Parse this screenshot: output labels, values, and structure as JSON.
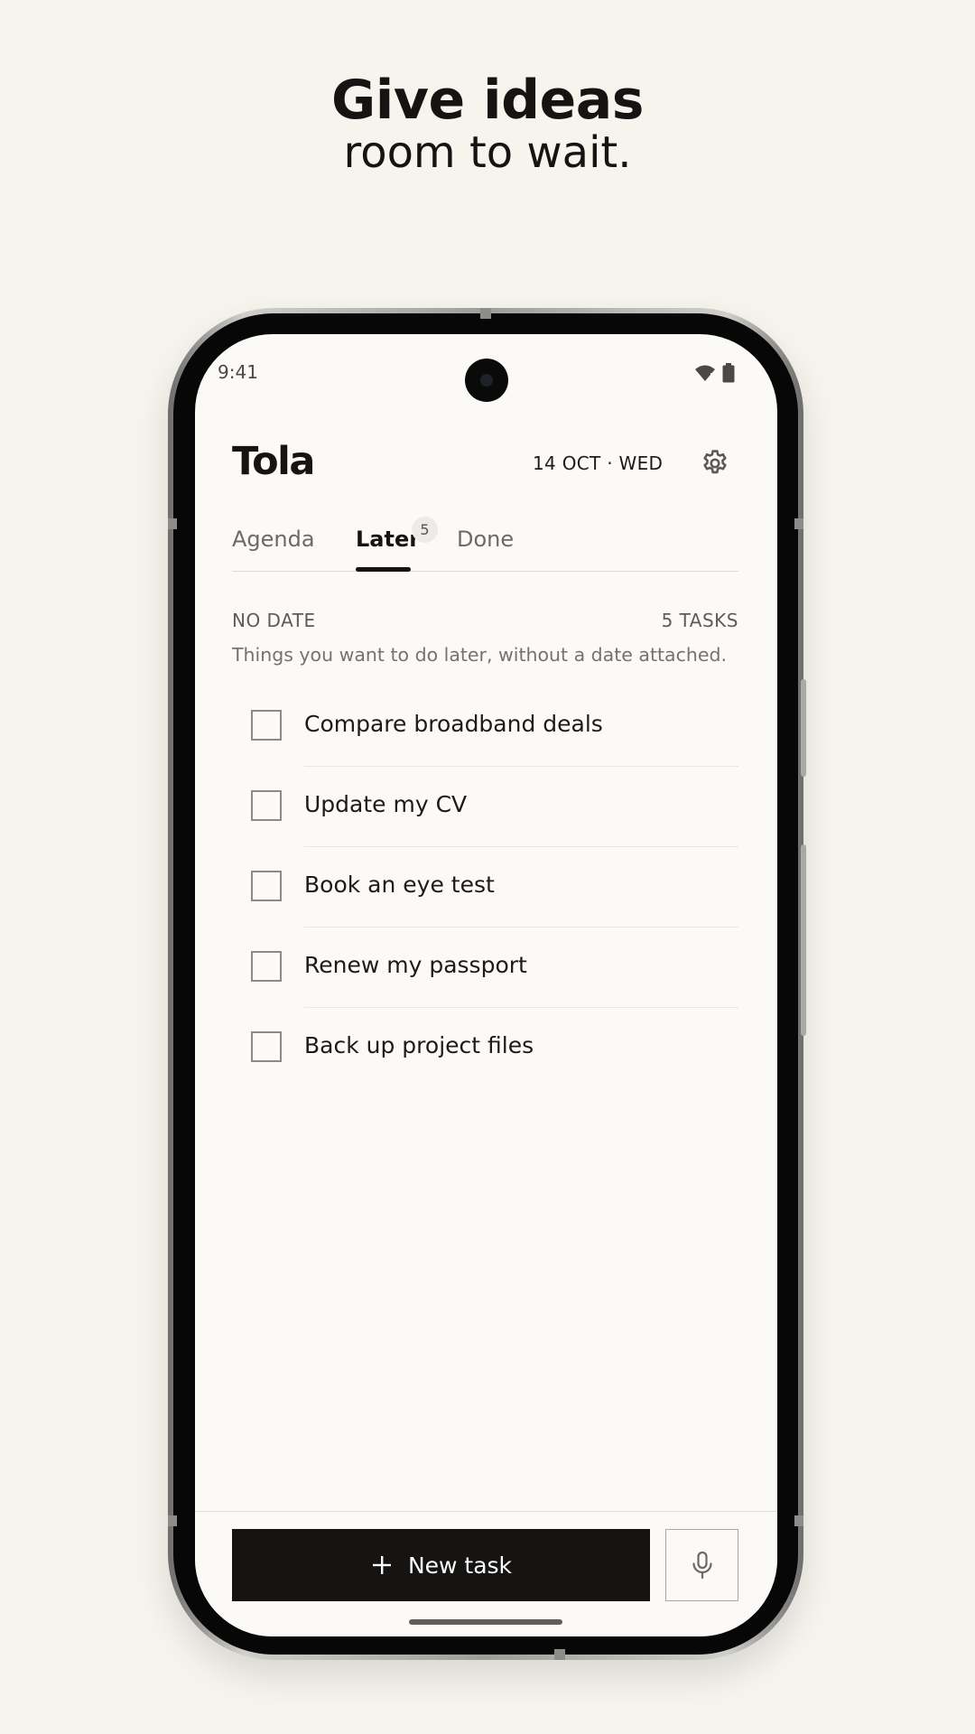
{
  "headline": {
    "line1": "Give ideas",
    "line2": "room to wait."
  },
  "status_bar": {
    "time": "9:41",
    "icons": [
      "wifi-icon",
      "battery-icon"
    ]
  },
  "app": {
    "title": "Tola",
    "date": "14 OCT · WED",
    "settings_icon": "gear-icon"
  },
  "tabs": [
    {
      "label": "Agenda",
      "active": false
    },
    {
      "label": "Later",
      "active": true,
      "badge": "5"
    },
    {
      "label": "Done",
      "active": false
    }
  ],
  "section": {
    "label": "NO DATE",
    "count": "5 TASKS",
    "description": "Things you want to do later, without a date attached."
  },
  "tasks": [
    {
      "label": "Compare broadband deals",
      "checked": false
    },
    {
      "label": "Update my CV",
      "checked": false
    },
    {
      "label": "Book an eye test",
      "checked": false
    },
    {
      "label": "Renew my passport",
      "checked": false
    },
    {
      "label": "Back up project files",
      "checked": false
    }
  ],
  "bottom_bar": {
    "new_task_label": "New task",
    "new_task_icon": "plus-icon",
    "mic_icon": "microphone-icon"
  },
  "colors": {
    "accent": "#151412",
    "background": "#f7f4ee",
    "screen": "#fbfaf7"
  }
}
